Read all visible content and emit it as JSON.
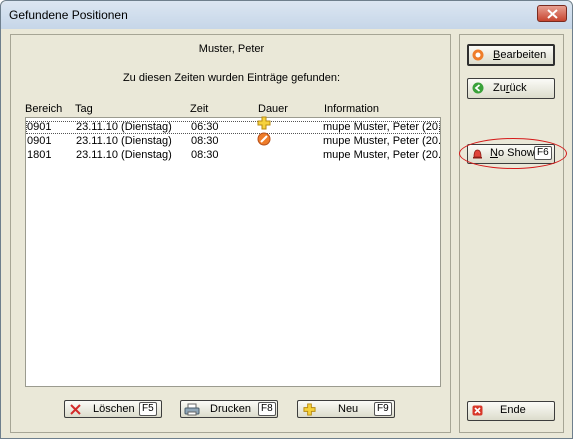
{
  "window": {
    "title": "Gefundene Positionen"
  },
  "header": {
    "person": "Muster, Peter",
    "message": "Zu diesen Zeiten wurden Einträge gefunden:"
  },
  "table": {
    "columns": [
      "Bereich",
      "Tag",
      "Zeit",
      "Dauer",
      "Information"
    ],
    "rows": [
      {
        "bereich": "0901",
        "tag": "23.11.10 (Dienstag)",
        "zeit": "06:30",
        "dauer_icon": "plus-icon",
        "information": "mupe  Muster, Peter (20."
      },
      {
        "bereich": "0901",
        "tag": "23.11.10 (Dienstag)",
        "zeit": "08:30",
        "dauer_icon": "no-entry-icon",
        "information": "mupe  Muster, Peter (20."
      },
      {
        "bereich": "1801",
        "tag": "23.11.10 (Dienstag)",
        "zeit": "08:30",
        "dauer_icon": "",
        "information": "mupe  Muster, Peter (20."
      }
    ]
  },
  "bottom_buttons": {
    "delete": {
      "label": "Löschen",
      "key": "F5"
    },
    "print": {
      "label": "Drucken",
      "key": "F8"
    },
    "new": {
      "label": "Neu",
      "key": "F9"
    }
  },
  "side_buttons": {
    "edit": {
      "label": "Bearbeiten"
    },
    "back": {
      "label": "Zurück"
    },
    "noshow": {
      "label": "No Show",
      "key": "F6"
    },
    "end": {
      "label": "Ende"
    }
  },
  "colors": {
    "highlight": "#d51a1a",
    "selection_outline": "#555555"
  }
}
